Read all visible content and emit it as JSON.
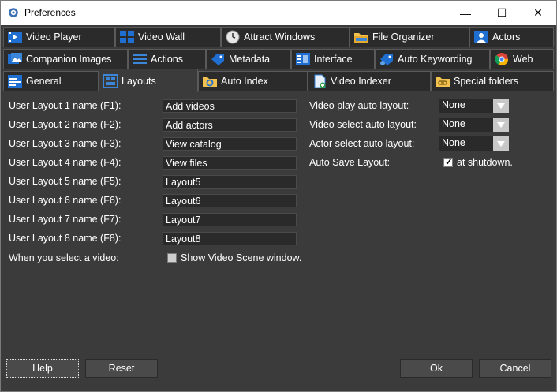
{
  "window": {
    "title": "Preferences",
    "minimize": "—",
    "maximize": "☐",
    "close": "✕"
  },
  "tabs_row1": [
    {
      "label": "Video Player",
      "icon": "video-player-icon"
    },
    {
      "label": "Video Wall",
      "icon": "video-wall-icon"
    },
    {
      "label": "Attract Windows",
      "icon": "clock-icon"
    },
    {
      "label": "File Organizer",
      "icon": "folder-icon"
    },
    {
      "label": "Actors",
      "icon": "person-icon"
    }
  ],
  "tabs_row2": [
    {
      "label": "Companion Images",
      "icon": "images-icon"
    },
    {
      "label": "Actions",
      "icon": "list-icon"
    },
    {
      "label": "Metadata",
      "icon": "tag-icon"
    },
    {
      "label": "Interface",
      "icon": "interface-icon"
    },
    {
      "label": "Auto Keywording",
      "icon": "keyword-tag-icon"
    },
    {
      "label": "Web",
      "icon": "chrome-icon"
    }
  ],
  "tabs_row3": [
    {
      "label": "General",
      "icon": "general-icon"
    },
    {
      "label": "Layouts",
      "icon": "layouts-icon"
    },
    {
      "label": "Auto Index",
      "icon": "auto-index-icon"
    },
    {
      "label": "Video Indexer",
      "icon": "document-icon"
    },
    {
      "label": "Special folders",
      "icon": "link-folder-icon"
    }
  ],
  "layouts": [
    {
      "label": "User Layout 1 name (F1):",
      "value": "Add videos"
    },
    {
      "label": "User Layout 2 name (F2):",
      "value": "Add actors"
    },
    {
      "label": "User Layout 3 name (F3):",
      "value": "View catalog"
    },
    {
      "label": "User Layout 4 name (F4):",
      "value": "View files"
    },
    {
      "label": "User Layout 5 name (F5):",
      "value": "Layout5"
    },
    {
      "label": "User Layout 6 name (F6):",
      "value": "Layout6"
    },
    {
      "label": "User Layout 7 name (F7):",
      "value": "Layout7"
    },
    {
      "label": "User Layout 8 name (F8):",
      "value": "Layout8"
    }
  ],
  "select_video": {
    "label": "When you select a video:",
    "checkbox_label": "Show Video Scene window.",
    "checked": false
  },
  "auto_layouts": [
    {
      "label": "Video play auto layout:",
      "value": "None"
    },
    {
      "label": "Video select auto layout:",
      "value": "None"
    },
    {
      "label": "Actor select auto layout:",
      "value": "None"
    }
  ],
  "auto_save": {
    "label": "Auto Save Layout:",
    "checkbox_label": "at shutdown.",
    "checked": true
  },
  "footer": {
    "help": "Help",
    "reset": "Reset",
    "ok": "Ok",
    "cancel": "Cancel"
  },
  "colors": {
    "panel": "#3b3b3b",
    "tab": "#2b2b2b",
    "field": "#2a2a2a",
    "accent_blue": "#2f7fe0"
  }
}
